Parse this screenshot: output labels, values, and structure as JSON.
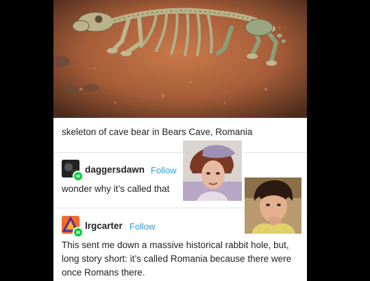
{
  "image": {
    "caption": "skeleton of cave bear in Bears Cave, Romania"
  },
  "reblog1": {
    "username": "daggersdawn",
    "follow_label": "Follow",
    "text": "wonder why it’s called that"
  },
  "reblog2": {
    "username": "lrgcarter",
    "follow_label": "Follow",
    "text": "This sent me down a massive historical rabbit hole, but, long story short: it’s called Romania because there were once Romans there."
  },
  "colors": {
    "follow": "#2aa0d4",
    "reblog_badge": "#00cf35",
    "background": "#000000",
    "card": "#ffffff"
  }
}
